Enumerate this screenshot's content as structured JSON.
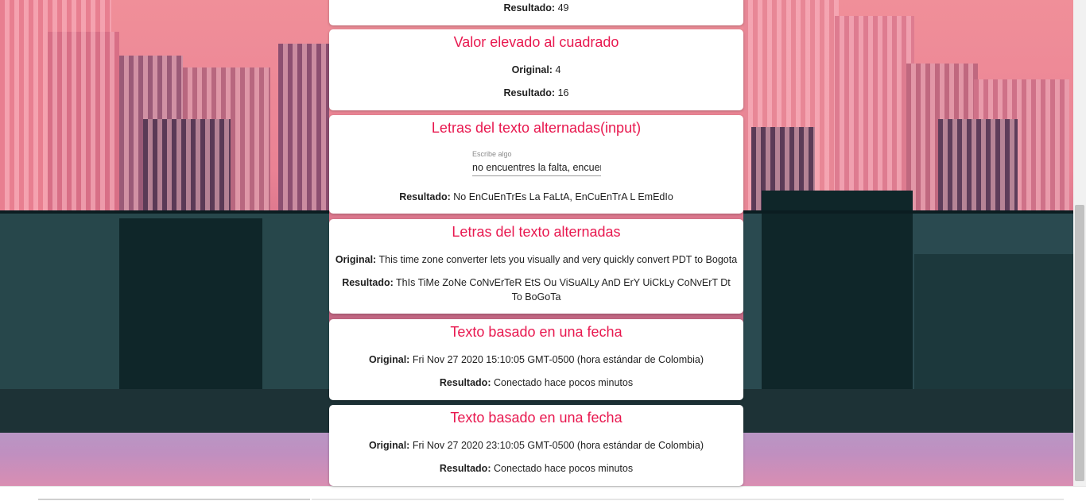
{
  "cards": [
    {
      "result_label": "Resultado:",
      "result_value": "49"
    },
    {
      "title": "Valor elevado al cuadrado",
      "original_label": "Original:",
      "original_value": "4",
      "result_label": "Resultado:",
      "result_value": "16"
    },
    {
      "title": "Letras del texto alternadas(input)",
      "input_label": "Escribe algo",
      "input_value": "no encuentres la falta, encuentra el remedio",
      "result_label": "Resultado:",
      "result_value": "No EnCuEnTrEs La FaLtA, EnCuEnTrA L EmEdIo"
    },
    {
      "title": "Letras del texto alternadas",
      "original_label": "Original:",
      "original_value": "This time zone converter lets you visually and very quickly convert PDT to Bogota",
      "result_label": "Resultado:",
      "result_value": "ThIs TiMe ZoNe CoNvErTeR EtS Ou ViSuAlLy AnD ErY UiCkLy CoNvErT Dt To BoGoTa"
    },
    {
      "title": "Texto basado en una fecha",
      "original_label": "Original:",
      "original_value": "Fri Nov 27 2020 15:10:05 GMT-0500 (hora estándar de Colombia)",
      "result_label": "Resultado:",
      "result_value": "Conectado hace pocos minutos"
    },
    {
      "title": "Texto basado en una fecha",
      "original_label": "Original:",
      "original_value": "Fri Nov 27 2020 23:10:05 GMT-0500 (hora estándar de Colombia)",
      "result_label": "Resultado:",
      "result_value": "Conectado hace pocos minutos"
    }
  ],
  "colors": {
    "title": "#e8184f",
    "card_bg": "#ffffff"
  }
}
